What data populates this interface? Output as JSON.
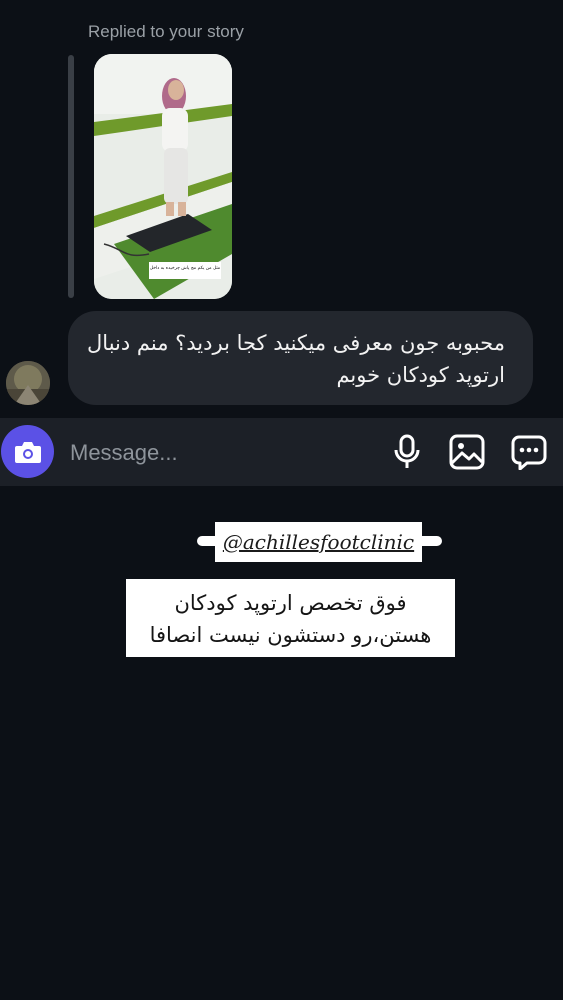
{
  "thread": {
    "reply_label": "Replied to your story",
    "story_caption": "مثل من یکم مچ پاش چرخیده به داخل"
  },
  "message": {
    "text": "محبوبه جون معرفی میکنید کجا بردید؟ منم دنبال ارتوپد کودکان خوبم"
  },
  "composer": {
    "placeholder": "Message...",
    "icons": [
      "camera-icon",
      "microphone-icon",
      "gallery-icon",
      "sticker-icon"
    ],
    "camera_color": "#5b51e6"
  },
  "overlay": {
    "mention": "@achillesfootclinic",
    "caption": "فوق تخصص ارتوپد کودکان هستن،رو دستشون نیست انصافا"
  }
}
